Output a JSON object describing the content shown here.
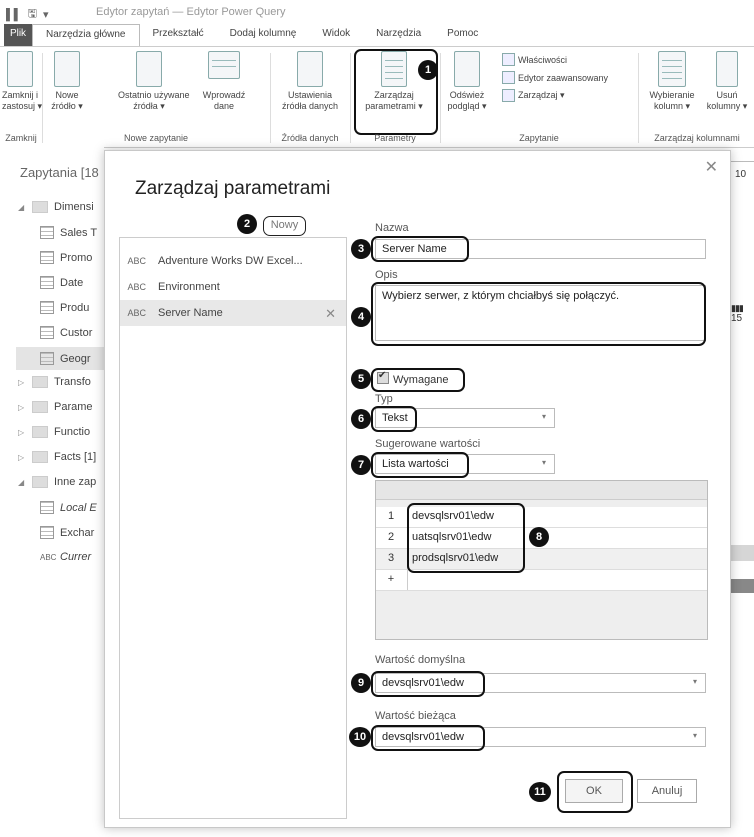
{
  "window": {
    "title": "Edytor zapytań — Edytor Power Query"
  },
  "tabs": [
    "Plik",
    "Narzędzia główne",
    "Przekształć",
    "Dodaj kolumnę",
    "Widok",
    "Narzędzia",
    "Pomoc"
  ],
  "ribbon": {
    "close_apply": "Zamknij i\nzastosuj ▾",
    "new_source": "Nowe\nźródło ▾",
    "recent_sources": "Ostatnio używane\nźródła ▾",
    "enter_data": "Wprowadź\ndane",
    "data_source_settings": "Ustawienia\nźródła danych",
    "manage_params": "Zarządzaj\nparametrami ▾",
    "refresh_preview": "Odśwież\npodgląd ▾",
    "properties": "Właściwości",
    "advanced_editor": "Edytor zaawansowany",
    "manage": "Zarządzaj ▾",
    "choose_columns": "Wybieranie\nkolumn ▾",
    "remove_columns": "Usuń\nkolumny ▾",
    "groups": {
      "close": "Zamknij",
      "new_query": "Nowe zapytanie",
      "data_sources": "Źródła danych",
      "parameters": "Parametry",
      "query": "Zapytanie",
      "manage_columns": "Zarządzaj kolumnami"
    }
  },
  "queries": {
    "title": "Zapytania [18",
    "items": [
      {
        "label": "Dimensi",
        "type": "folder",
        "expanded": true
      },
      {
        "label": "Sales T",
        "type": "table"
      },
      {
        "label": "Promo",
        "type": "table"
      },
      {
        "label": "Date",
        "type": "table"
      },
      {
        "label": "Produ",
        "type": "table"
      },
      {
        "label": "Custor",
        "type": "table"
      },
      {
        "label": "Geogr",
        "type": "table"
      },
      {
        "label": "Transfo",
        "type": "folder"
      },
      {
        "label": "Parame",
        "type": "folder"
      },
      {
        "label": "Functio",
        "type": "folder"
      },
      {
        "label": "Facts [1]",
        "type": "folder"
      },
      {
        "label": "Inne zap",
        "type": "folder",
        "expanded": true
      },
      {
        "label": "Local E",
        "type": "local"
      },
      {
        "label": "Exchar",
        "type": "table"
      },
      {
        "label": "Currer",
        "type": "param"
      }
    ]
  },
  "dialog": {
    "title": "Zarządzaj parametrami",
    "new_button": "Nowy",
    "parameters": [
      {
        "name": "Adventure Works DW Excel...",
        "type_icon": "ABC"
      },
      {
        "name": "Environment",
        "type_icon": "ABC"
      },
      {
        "name": "Server Name",
        "type_icon": "ABC"
      }
    ],
    "name_label": "Nazwa",
    "name_value": "Server Name",
    "desc_label": "Opis",
    "desc_value": "Wybierz serwer, z którym chciałbyś się połączyć.",
    "required_label": "Wymagane",
    "type_label": "Typ",
    "type_value": "Tekst",
    "suggested_label": "Sugerowane wartości",
    "suggested_value": "Lista wartości",
    "values": [
      "devsqlsrv01\\edw",
      "uatsqlsrv01\\edw",
      "prodsqlsrv01\\edw"
    ],
    "add_row": "+",
    "default_label": "Wartość domyślna",
    "default_value": "devsqlsrv01\\edw",
    "current_label": "Wartość bieżąca",
    "current_value": "devsqlsrv01\\edw",
    "ok": "OK",
    "cancel": "Anuluj"
  },
  "callouts": [
    "1",
    "2",
    "3",
    "4",
    "5",
    "6",
    "7",
    "8",
    "9",
    "10",
    "11"
  ],
  "edge": {
    "top": "10",
    "mid": "15"
  }
}
